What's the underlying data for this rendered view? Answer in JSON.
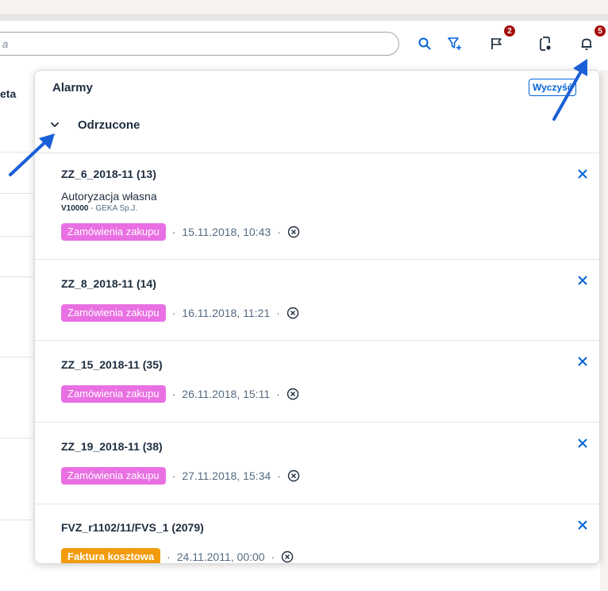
{
  "search": {
    "text": "a"
  },
  "header_badges": {
    "flag_count": "2",
    "bell_count": "5"
  },
  "background": {
    "tab_label": "eta"
  },
  "panel": {
    "title": "Alarmy",
    "clear_label": "Wyczyść",
    "group_title": "Odrzucone"
  },
  "cards": [
    {
      "title": "ZZ_6_2018-11 (13)",
      "subtitle": "Autoryzacja własna",
      "vendor_code": "V10000",
      "vendor_name": " - GEKA Sp.J.",
      "tag": "Zamówienia zakupu",
      "date": "15.11.2018, 10:43"
    },
    {
      "title": "ZZ_8_2018-11 (14)",
      "tag": "Zamówienia zakupu",
      "date": "16.11.2018, 11:21"
    },
    {
      "title": "ZZ_15_2018-11 (35)",
      "tag": "Zamówienia zakupu",
      "date": "26.11.2018, 15:11"
    },
    {
      "title": "ZZ_19_2018-11 (38)",
      "tag": "Zamówienia zakupu",
      "date": "27.11.2018, 15:34"
    },
    {
      "title": "FVZ_r1102/11/FVS_1 (2079)",
      "tag": "Faktura kosztowa",
      "date": "24.11.2011, 00:00"
    }
  ],
  "colors": {
    "accent": "#0064d9",
    "tag_purchase": "#e970e2",
    "tag_invoice": "#f29b0c",
    "badge": "#a40b0b",
    "arrow": "#1a5fd6"
  },
  "icons": [
    "search-icon",
    "filter-add-icon",
    "flag-icon",
    "phone-settings-icon",
    "bell-icon",
    "chevron-down-icon",
    "close-icon",
    "dismiss-circle-icon"
  ]
}
